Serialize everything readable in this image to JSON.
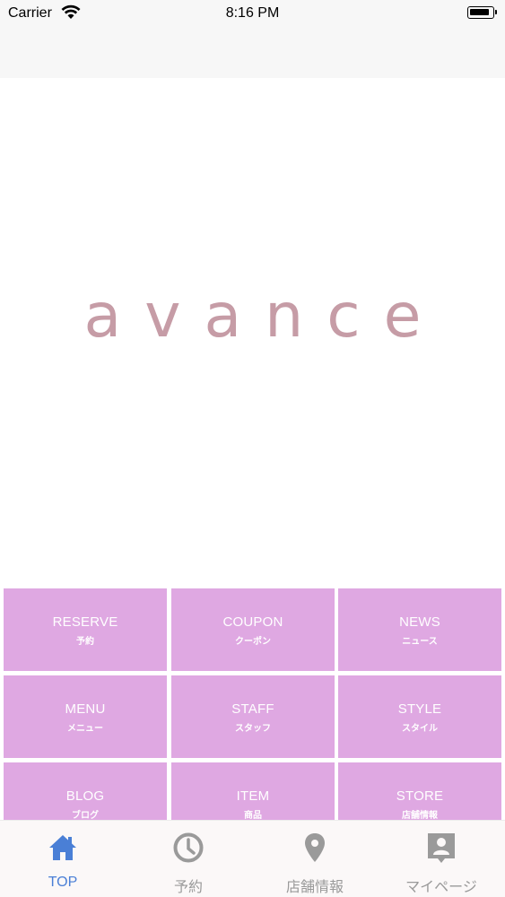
{
  "status_bar": {
    "carrier": "Carrier",
    "time": "8:16 PM"
  },
  "hero": {
    "logo_text": "avance",
    "logo_color": "#c69ca6"
  },
  "menu": {
    "tile_color": "#dfa8e2",
    "tiles": [
      {
        "en": "RESERVE",
        "ja": "予約"
      },
      {
        "en": "COUPON",
        "ja": "クーポン"
      },
      {
        "en": "NEWS",
        "ja": "ニュース"
      },
      {
        "en": "MENU",
        "ja": "メニュー"
      },
      {
        "en": "STAFF",
        "ja": "スタッフ"
      },
      {
        "en": "STYLE",
        "ja": "スタイル"
      },
      {
        "en": "BLOG",
        "ja": "ブログ"
      },
      {
        "en": "ITEM",
        "ja": "商品"
      },
      {
        "en": "STORE",
        "ja": "店舗情報"
      }
    ]
  },
  "tab_bar": {
    "active_color": "#4a7fd6",
    "inactive_color": "#9a9a9a",
    "tabs": [
      {
        "label": "TOP",
        "icon": "home-icon",
        "active": true
      },
      {
        "label": "予約",
        "icon": "clock-icon",
        "active": false
      },
      {
        "label": "店舗情報",
        "icon": "location-pin-icon",
        "active": false
      },
      {
        "label": "マイページ",
        "icon": "profile-badge-icon",
        "active": false
      }
    ]
  }
}
